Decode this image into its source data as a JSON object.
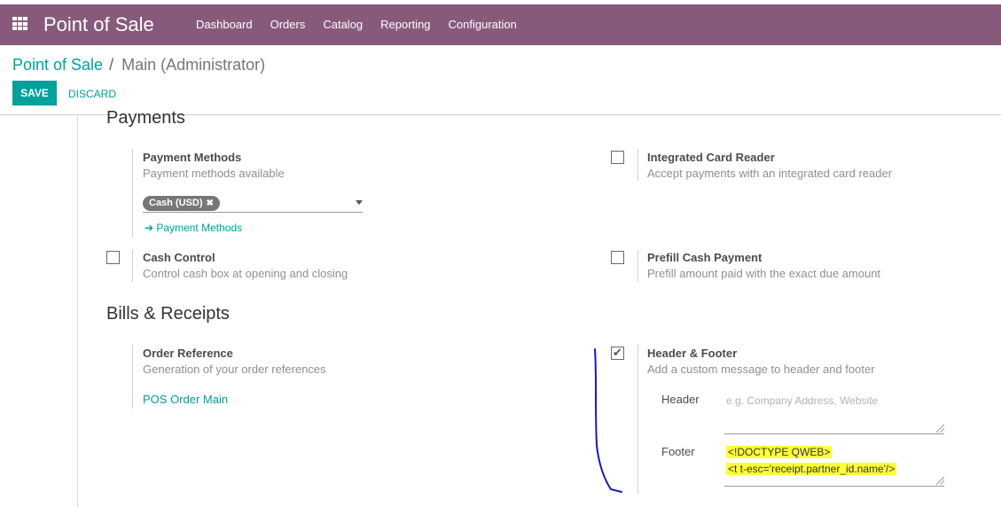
{
  "topbar": {
    "app_title": "Point of Sale",
    "menu": [
      "Dashboard",
      "Orders",
      "Catalog",
      "Reporting",
      "Configuration"
    ],
    "bg_color": "#875a7b"
  },
  "breadcrumb": {
    "parent": "Point of Sale",
    "separator": "/",
    "current": "Main (Administrator)"
  },
  "buttons": {
    "save": "SAVE",
    "discard": "DISCARD"
  },
  "payments": {
    "title": "Payments",
    "payment_methods": {
      "label": "Payment Methods",
      "desc": "Payment methods available",
      "tag": "Cash (USD)",
      "tag_remove": "✖",
      "link": "Payment Methods",
      "link_arrow": "➔"
    },
    "integrated_card_reader": {
      "label": "Integrated Card Reader",
      "desc": "Accept payments with an integrated card reader",
      "checked": false
    },
    "cash_control": {
      "label": "Cash Control",
      "desc": "Control cash box at opening and closing",
      "checked": false
    },
    "prefill_cash": {
      "label": "Prefill Cash Payment",
      "desc": "Prefill amount paid with the exact due amount",
      "checked": false
    }
  },
  "bills": {
    "title": "Bills & Receipts",
    "order_reference": {
      "label": "Order Reference",
      "desc": "Generation of your order references",
      "link": "POS Order Main"
    },
    "header_footer": {
      "label": "Header & Footer",
      "desc": "Add a custom message to header and footer",
      "checked": true,
      "header_label": "Header",
      "header_placeholder": "e.g. Company Address, Website",
      "footer_label": "Footer",
      "footer_line1": "<!DOCTYPE QWEB>",
      "footer_line2": "<t t-esc='receipt.partner_id.name'/>"
    }
  },
  "colors": {
    "accent": "#00a09d",
    "highlight": "#ffff3a",
    "annotation": "#1a1ab0"
  }
}
